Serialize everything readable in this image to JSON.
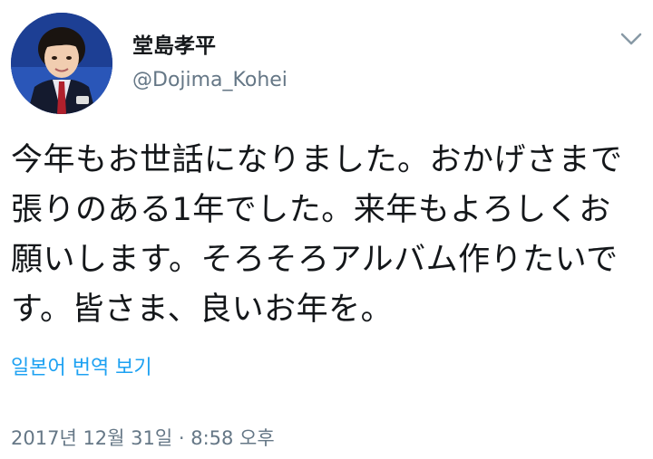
{
  "tweet": {
    "author": {
      "display_name": "堂島孝平",
      "handle": "@Dojima_Kohei",
      "avatar_icon": "profile-photo",
      "menu_icon": "chevron-down-icon"
    },
    "text_lines": [
      "今年もお世話になりました。おかげさまで",
      "張りのある1年でした。来年もよろしくお",
      "願いします。そろそろアルバム作りたいで",
      "す。皆さま、良いお年を。"
    ],
    "translate_label": "일본어 번역 보기",
    "timestamp": "2017년 12월 31일 · 8:58 오후"
  },
  "colors": {
    "text": "#14171a",
    "secondary": "#657786",
    "link": "#1da1f2",
    "background": "#ffffff"
  }
}
